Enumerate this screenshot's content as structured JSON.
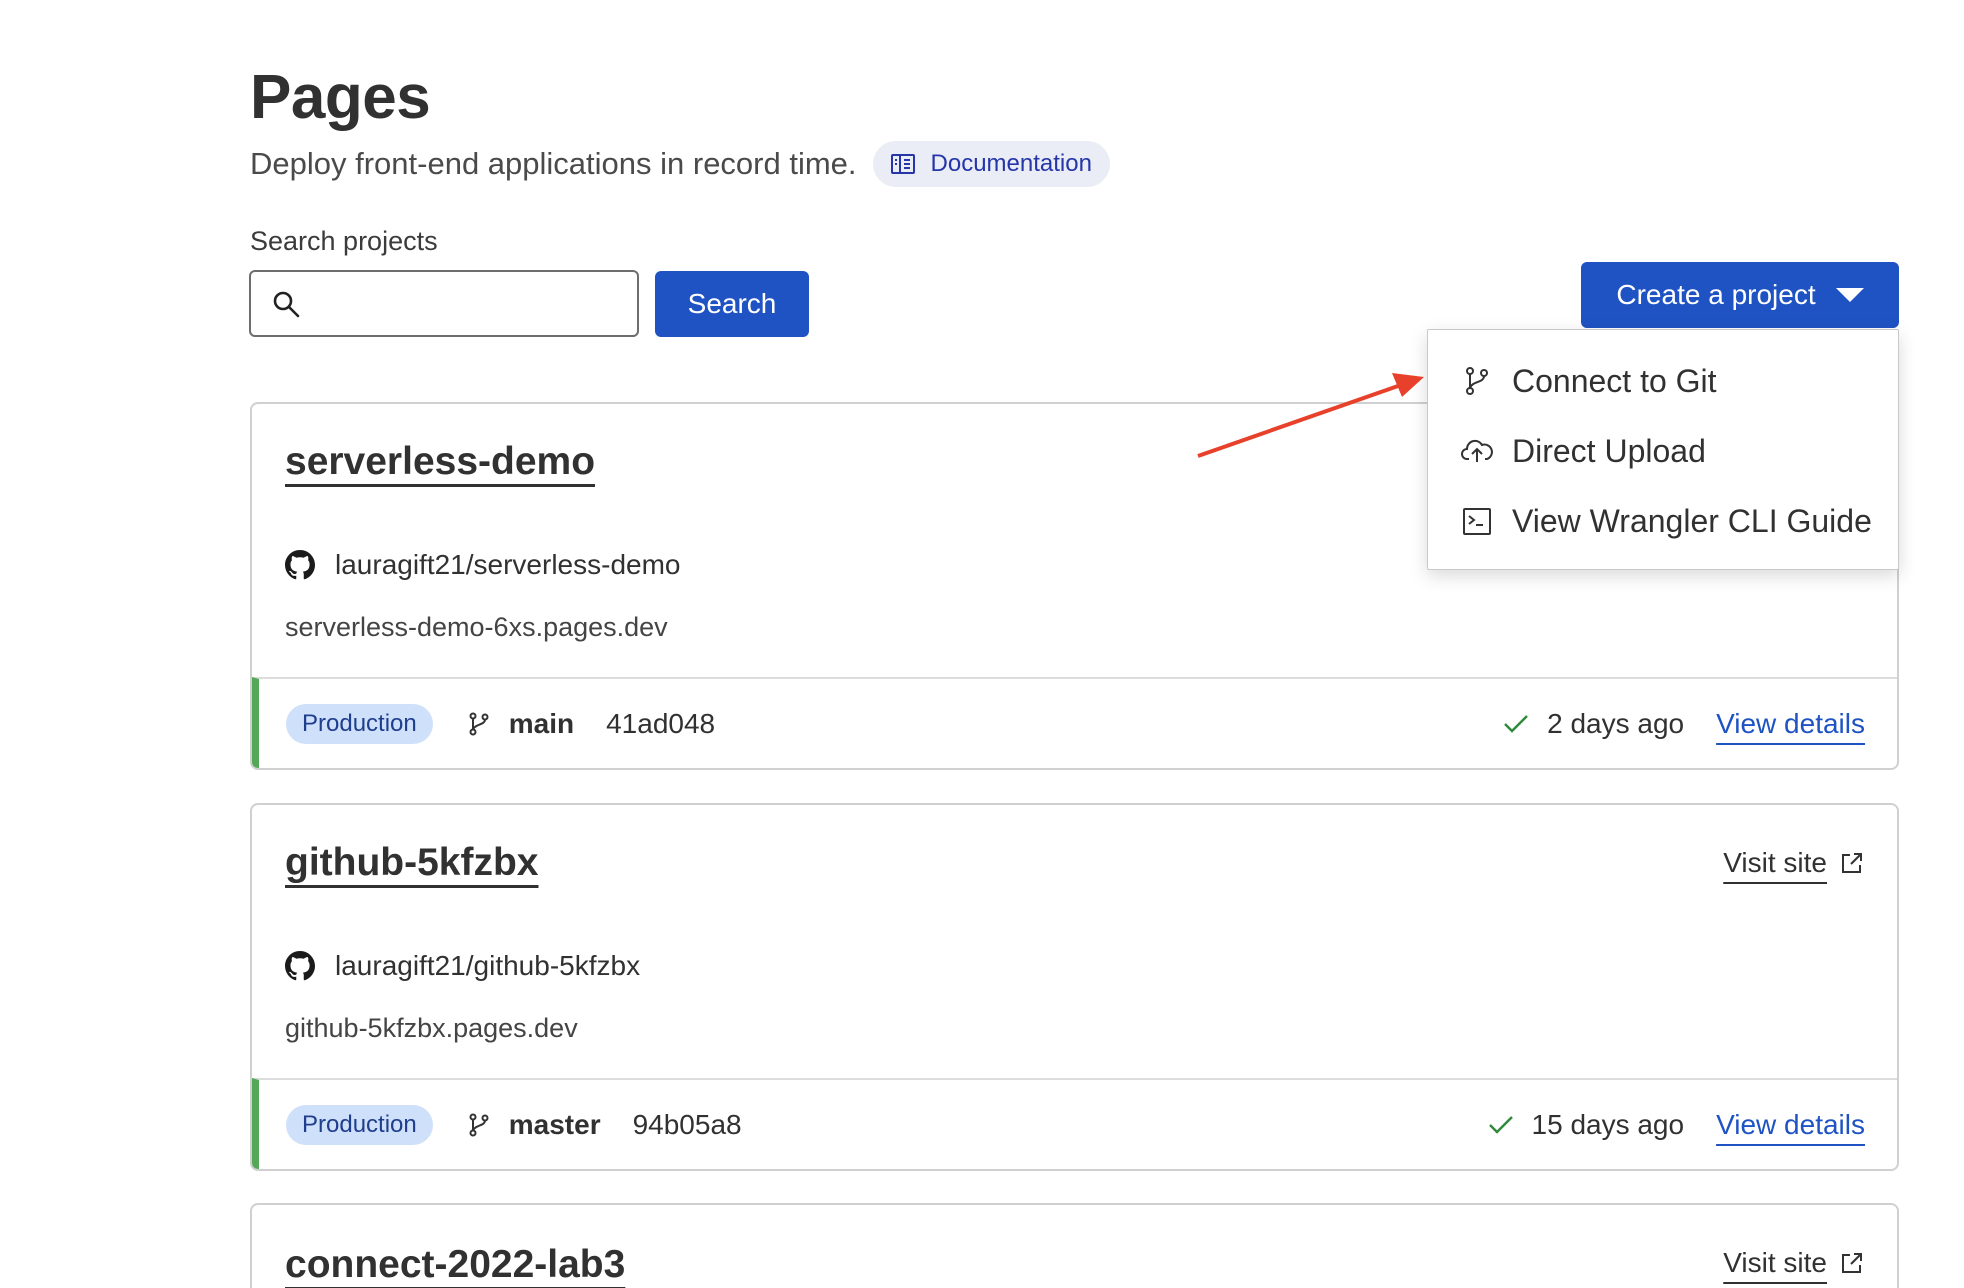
{
  "page": {
    "title": "Pages",
    "subtitle": "Deploy front-end applications in record time.",
    "doc_link_label": "Documentation"
  },
  "search": {
    "label": "Search projects",
    "value": "",
    "button_label": "Search"
  },
  "create_project": {
    "label": "Create a project",
    "menu": [
      {
        "label": "Connect to Git",
        "icon": "git-branch-icon"
      },
      {
        "label": "Direct Upload",
        "icon": "cloud-upload-icon"
      },
      {
        "label": "View Wrangler CLI Guide",
        "icon": "terminal-icon"
      }
    ]
  },
  "colors": {
    "primary": "#1f53c3",
    "badge_bg": "#cfe0fa",
    "success_green": "#54a857",
    "annotation_arrow": "#e8412b"
  },
  "projects": [
    {
      "name": "serverless-demo",
      "repo": "lauragift21/serverless-demo",
      "domain": "serverless-demo-6xs.pages.dev",
      "visit_label": "",
      "env_badge": "Production",
      "branch": "main",
      "commit": "41ad048",
      "updated": "2 days ago",
      "details_label": "View details"
    },
    {
      "name": "github-5kfzbx",
      "repo": "lauragift21/github-5kfzbx",
      "domain": "github-5kfzbx.pages.dev",
      "visit_label": "Visit site",
      "env_badge": "Production",
      "branch": "master",
      "commit": "94b05a8",
      "updated": "15 days ago",
      "details_label": "View details"
    },
    {
      "name": "connect-2022-lab3",
      "visit_label": "Visit site"
    }
  ]
}
